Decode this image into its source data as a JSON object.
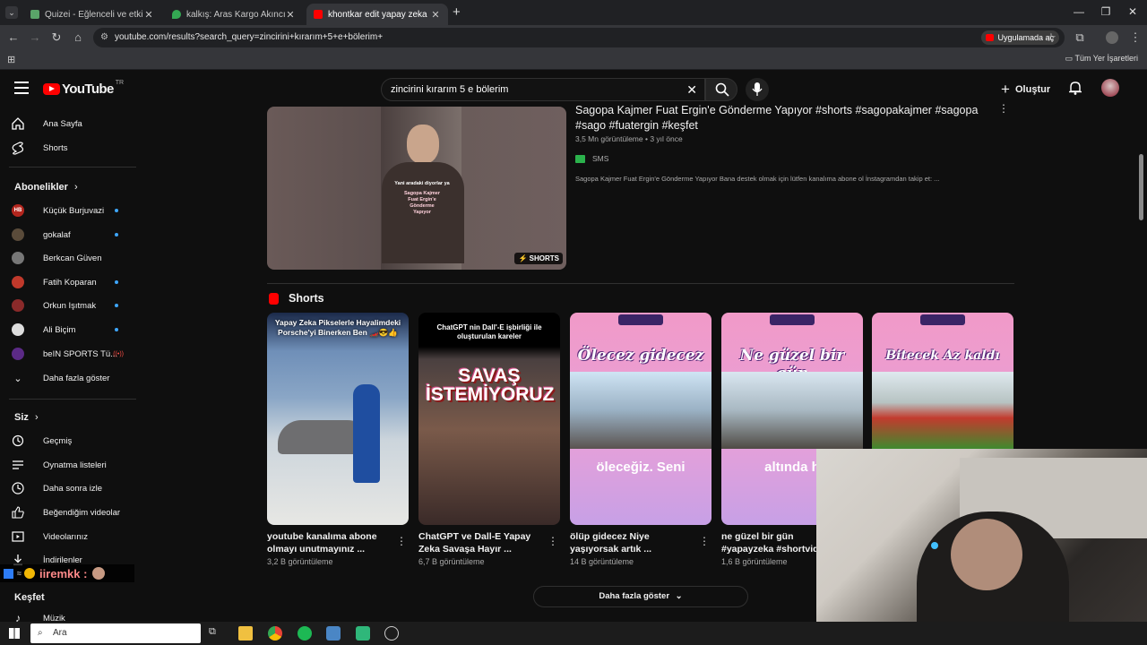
{
  "browser": {
    "tabs": [
      {
        "label": "Quizei - Eğlenceli ve etkileşimli",
        "active": false
      },
      {
        "label": "kalkış: Aras Kargo Akıncı Şubesi",
        "active": false
      },
      {
        "label": "khontkar edit yapay zeka bloke",
        "active": true
      }
    ],
    "url": "youtube.com/results?search_query=zincirini+kırarım+5+e+bölerim+",
    "open_app_label": "Uygulamada aç",
    "bookmarks_all": "Tüm Yer İşaretleri"
  },
  "masthead": {
    "logo_text": "YouTube",
    "region": "TR",
    "search_value": "zincirini kırarım 5 e bölerim",
    "create_label": "Oluştur"
  },
  "sidebar": {
    "home": "Ana Sayfa",
    "shorts": "Shorts",
    "subscriptions_header": "Abonelikler",
    "subscriptions": [
      {
        "label": "Küçük Burjuvazi",
        "live": false,
        "new": true,
        "avatar_text": "HB",
        "color": "#b3261e"
      },
      {
        "label": "gokalaf",
        "live": false,
        "new": true,
        "avatar_text": "",
        "color": "#5a4b3a"
      },
      {
        "label": "Berkcan Güven",
        "live": false,
        "new": false,
        "avatar_text": "",
        "color": "#777777"
      },
      {
        "label": "Fatih Koparan",
        "live": false,
        "new": true,
        "avatar_text": "",
        "color": "#c0392b"
      },
      {
        "label": "Orkun Işıtmak",
        "live": false,
        "new": true,
        "avatar_text": "",
        "color": "#8a2a2a"
      },
      {
        "label": "Ali Biçim",
        "live": false,
        "new": true,
        "avatar_text": "",
        "color": "#dddddd"
      },
      {
        "label": "beIN SPORTS Tü...",
        "live": true,
        "new": false,
        "avatar_text": "",
        "color": "#5b2a86"
      }
    ],
    "show_more": "Daha fazla göster",
    "you_header": "Siz",
    "you_items": [
      "Geçmiş",
      "Oynatma listeleri",
      "Daha sonra izle",
      "Beğendiğim videolar",
      "Videolarınız",
      "İndirilenler"
    ],
    "explore_header": "Keşfet",
    "explore_items": [
      "Müzik"
    ]
  },
  "video": {
    "title": "Sagopa Kajmer Fuat Ergin'e Gönderme Yapıyor #shorts #sagopakajmer #sagopa #sago #fuatergin #keşfet",
    "views": "3,5 Mn görüntüleme",
    "age": "3 yıl önce",
    "channel": "SMS",
    "description": "Sagopa Kajmer Fuat Ergin'e Gönderme Yapıyor Bana destek olmak için lütfen kanalıma abone ol İnstagramdan takip et: ...",
    "badge": "SHORTS",
    "thumb_caption": [
      "Yani aradaki diyorlar ya",
      "Sagopa Kajmer",
      "Fuat Ergin'e",
      "Gönderme",
      "Yapıyor"
    ]
  },
  "shorts": {
    "header": "Shorts",
    "items": [
      {
        "title": "youtube kanalıma abone olmayı unutmayınız ...",
        "views": "3,2 B görüntüleme",
        "thumb_text": "Yapay Zeka Pikselerle Hayalimdeki Porsche'yi Binerken Ben 🏎️😎👍"
      },
      {
        "title": "ChatGPT ve Dall-E Yapay Zeka Savaşa Hayır ...",
        "views": "6,7 B görüntüleme",
        "thumb_text": "ChatGPT nin Dall'-E işbirliği ile oluşturulan kareler",
        "thumb_big": "SAVAŞ İSTEMİYORUZ"
      },
      {
        "title": "ölüp gidecez Niye yaşıyorsak artık ...",
        "views": "14 B görüntüleme",
        "thumb_text": "Ölecez gidecez",
        "thumb_sub": "öleceğiz. Seni"
      },
      {
        "title": "ne güzel bir gün #yapayzeka #shortvideo",
        "views": "1,6 B görüntüleme",
        "thumb_text": "Ne güzel bir gün",
        "thumb_sub": "altında h"
      },
      {
        "title": "Bitecek Az kaldı",
        "views": "",
        "thumb_text": "Bitecek Az kaldı",
        "thumb_sub": ""
      }
    ],
    "more_label": "Daha fazla göster"
  },
  "overlay": {
    "username": "iiremkk :"
  },
  "taskbar": {
    "search_label": "Ara"
  }
}
